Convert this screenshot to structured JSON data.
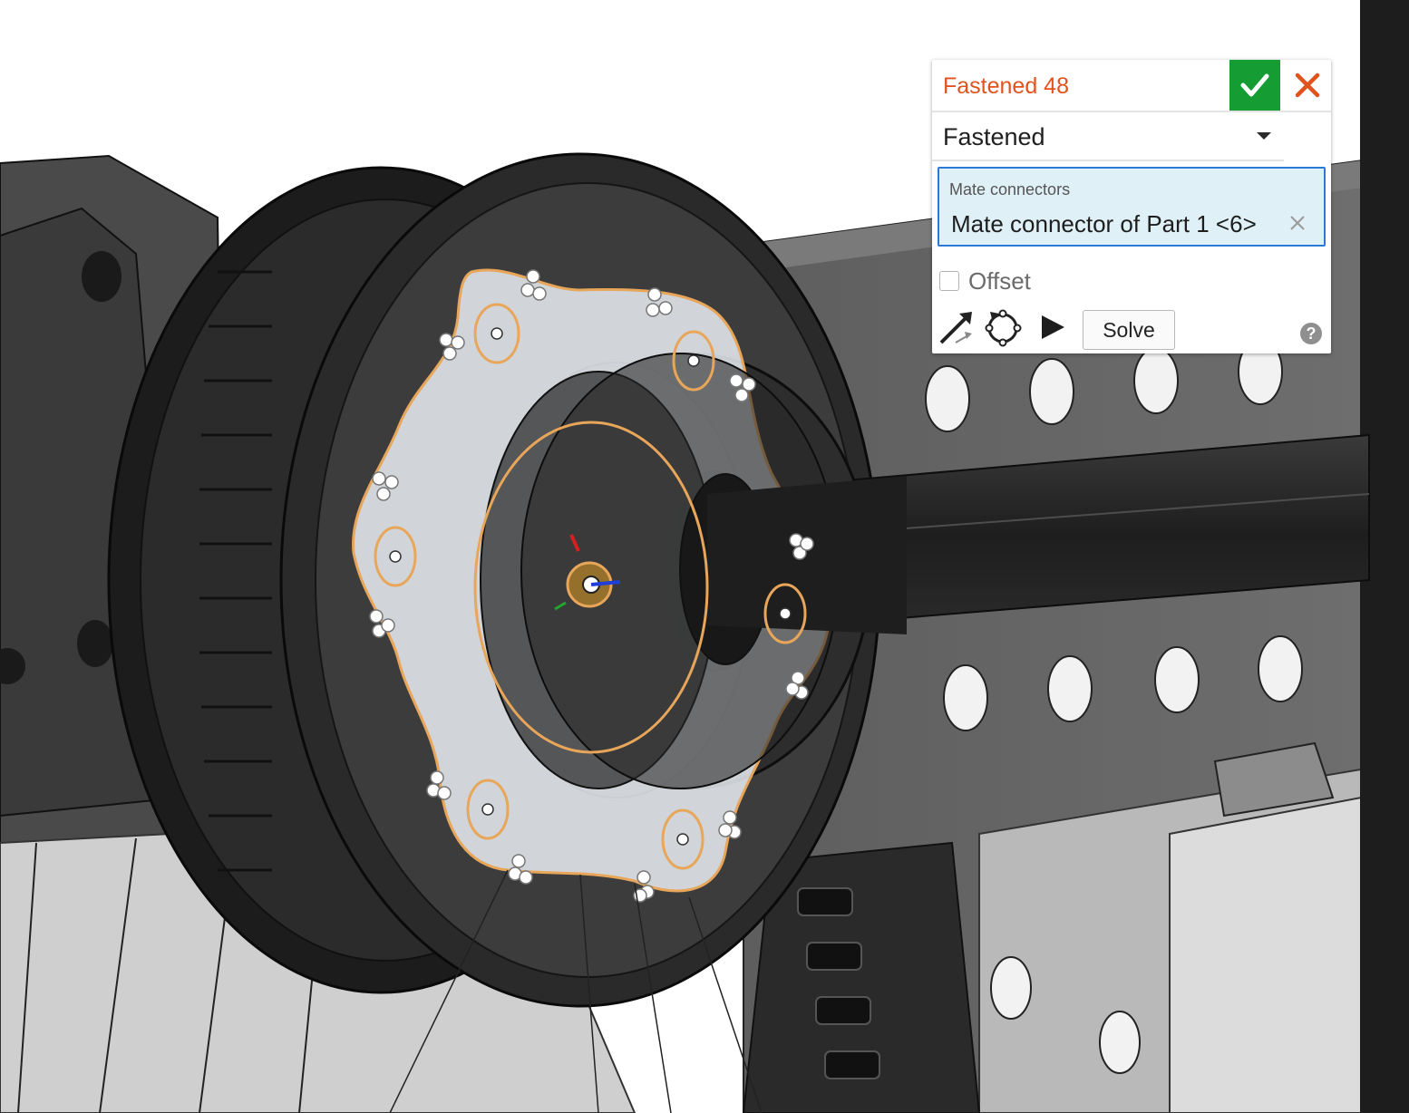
{
  "viewport": {
    "scene": "3d-assembly-pulley",
    "highlight_color": "#e8a65a",
    "mate_connector_icon": "triad-icon"
  },
  "mate_dialog": {
    "title": "Fastened 48",
    "title_color": "#e0531e",
    "accept_icon": "checkmark-icon",
    "accept_color": "#159c33",
    "cancel_icon": "close-icon",
    "mate_type": "Fastened",
    "connectors_label": "Mate connectors",
    "connector_value": "Mate connector of Part 1 <6>",
    "offset_label": "Offset",
    "offset_checked": false,
    "tools": [
      "flip-primary-axis-icon",
      "reorient-secondary-axis-icon",
      "animate-play-icon"
    ],
    "solve_label": "Solve",
    "help_label": "?"
  }
}
